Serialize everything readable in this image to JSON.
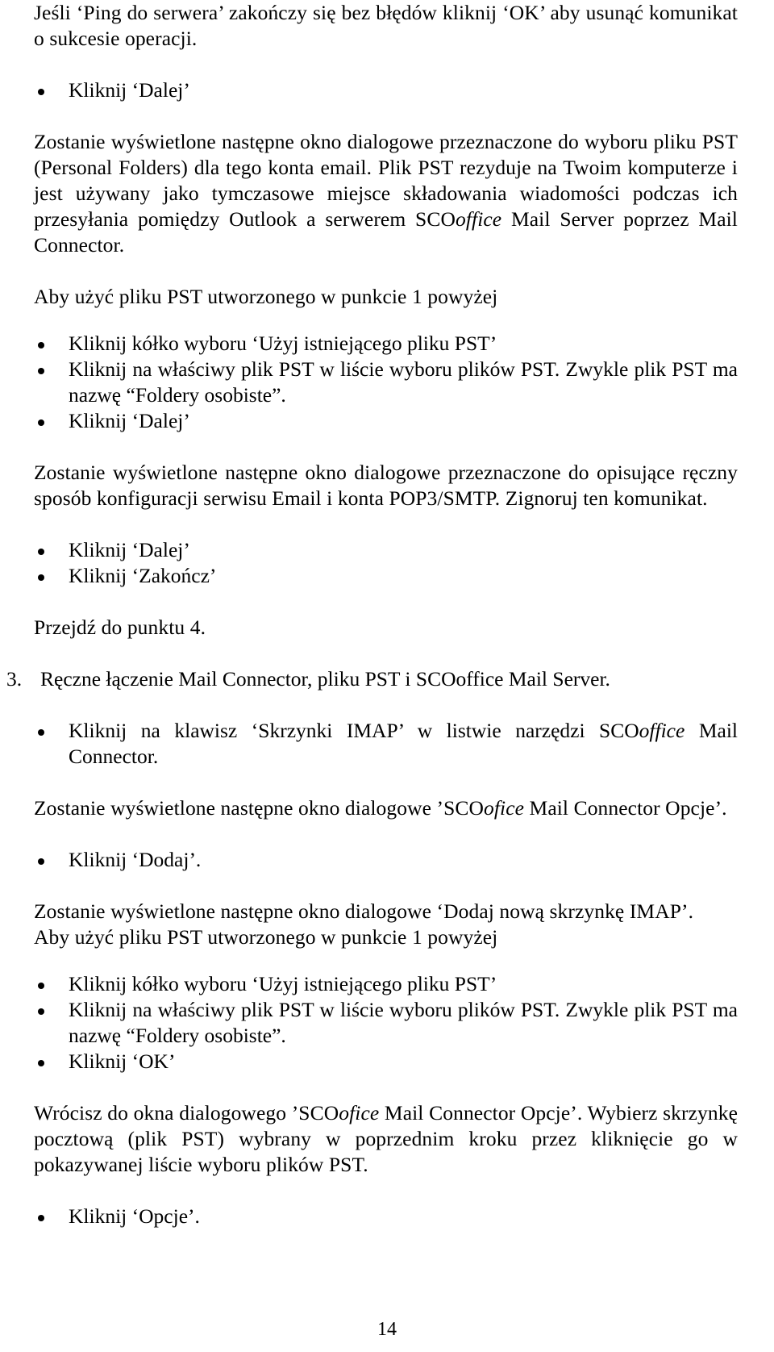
{
  "document": {
    "language": "pl",
    "page_number": "14",
    "body": {
      "p_intro": "Jeśli ‘Ping do serwera’ zakończy się bez błędów kliknij ‘OK’ aby usunąć komunikat o sukcesie operacji.",
      "bullet_dalej_1": "Kliknij ‘Dalej’",
      "p_pst_dialog_a": "Zostanie wyświetlone następne okno dialogowe przeznaczone do wyboru pliku PST (Personal Folders) dla tego konta email. Plik PST rezyduje na Twoim komputerze i jest używany jako tymczasowe miejsce składowania wiadomości podczas ich przesyłania pomiędzy Outlook a serwerem SCO",
      "p_pst_dialog_italic": "office",
      "p_pst_dialog_b": " Mail Server poprzez Mail Connector.",
      "p_aby_uzyc_1": "Aby użyć pliku PST utworzonego w punkcie 1 powyżej",
      "bullet_kolko_1": "Kliknij kółko wyboru ‘Użyj istniejącego pliku PST’",
      "bullet_wlasciwy_1": "Kliknij na właściwy plik PST w liście wyboru plików PST. Zwykle plik PST ma nazwę “Foldery osobiste”.",
      "bullet_dalej_2": "Kliknij ‘Dalej’",
      "p_pop3": "Zostanie wyświetlone następne okno dialogowe przeznaczone do opisujące ręczny sposób konfiguracji serwisu Email i konta POP3/SMTP. Zignoruj ten komunikat.",
      "bullet_dalej_3": "Kliknij ‘Dalej’",
      "bullet_zakoncz": "Kliknij ‘Zakończ’",
      "p_przejdz": "Przejdź do punktu 4.",
      "item3_number": "3.",
      "item3_text": "Ręczne łączenie Mail Connector, pliku PST i SCOoffice Mail Server.",
      "bullet_skrzynki_a": "Kliknij na klawisz ‘Skrzynki IMAP’ w listwie narzędzi SCO",
      "bullet_skrzynki_italic": "office",
      "bullet_skrzynki_b": " Mail Connector.",
      "p_opcje_dialog_a": "Zostanie wyświetlone następne okno dialogowe ’SCO",
      "p_opcje_dialog_italic": "ofice",
      "p_opcje_dialog_b": " Mail Connector Opcje’.",
      "bullet_dodaj": "Kliknij ‘Dodaj’.",
      "p_dodaj_imap": "Zostanie wyświetlone następne okno dialogowe ‘Dodaj nową skrzynkę IMAP’.",
      "p_aby_uzyc_2": "Aby użyć pliku PST utworzonego w punkcie 1 powyżej",
      "bullet_kolko_2": "Kliknij kółko wyboru ‘Użyj istniejącego pliku PST’",
      "bullet_wlasciwy_2": "Kliknij na właściwy plik PST w liście wyboru plików PST. Zwykle plik PST ma nazwę “Foldery osobiste”.",
      "bullet_ok": "Kliknij ‘OK’",
      "p_wrocisz_a": "Wrócisz do okna dialogowego ’SCO",
      "p_wrocisz_italic": "ofice",
      "p_wrocisz_b": " Mail Connector Opcje’. Wybierz skrzynkę pocztową (plik PST) wybrany w poprzednim kroku przez kliknięcie go w pokazywanej liście wyboru plików PST.",
      "bullet_opcje": "Kliknij ‘Opcje’."
    }
  }
}
